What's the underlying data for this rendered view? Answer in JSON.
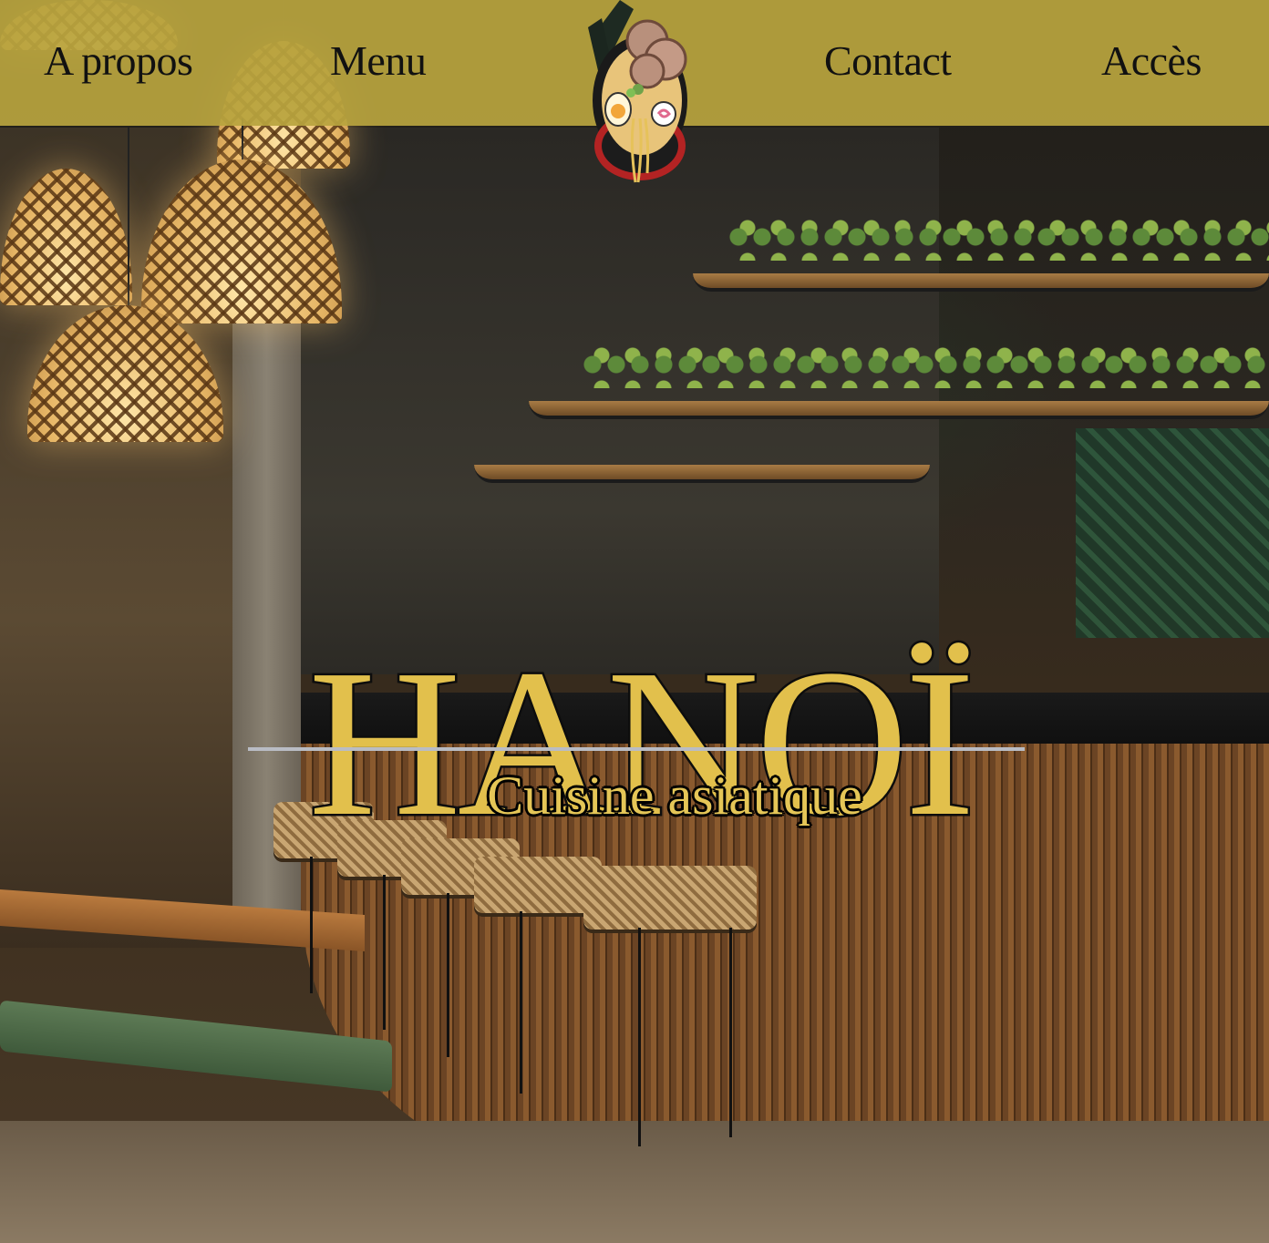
{
  "nav": {
    "items": [
      {
        "label": "A propos"
      },
      {
        "label": "Menu"
      },
      {
        "label": "Contact"
      },
      {
        "label": "Accès"
      }
    ],
    "logo_icon": "ramen-bowl-icon"
  },
  "hero": {
    "title": "HANOÏ",
    "subtitle": "Cuisine asiatique",
    "background_image": "restaurant-interior-photo"
  },
  "colors": {
    "navbar_bg": "#b8a43e",
    "title_fill": "#e2c04c",
    "title_stroke": "#0d0d0d",
    "rule": "#b9bcc4"
  }
}
